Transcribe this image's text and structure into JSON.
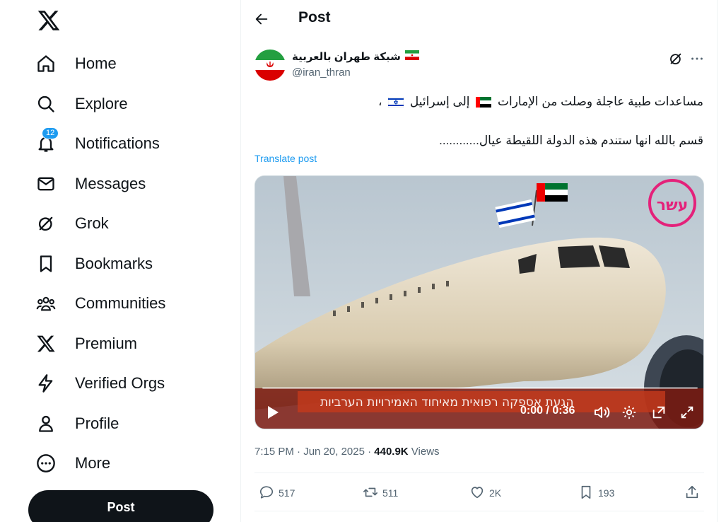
{
  "nav": {
    "items": [
      {
        "label": "Home",
        "icon": "home-icon"
      },
      {
        "label": "Explore",
        "icon": "search-icon"
      },
      {
        "label": "Notifications",
        "icon": "bell-icon",
        "badge": "12"
      },
      {
        "label": "Messages",
        "icon": "mail-icon"
      },
      {
        "label": "Grok",
        "icon": "grok-icon"
      },
      {
        "label": "Bookmarks",
        "icon": "bookmark-icon"
      },
      {
        "label": "Communities",
        "icon": "communities-icon"
      },
      {
        "label": "Premium",
        "icon": "x-logo-icon"
      },
      {
        "label": "Verified Orgs",
        "icon": "lightning-icon"
      },
      {
        "label": "Profile",
        "icon": "person-icon"
      },
      {
        "label": "More",
        "icon": "more-circle-icon"
      }
    ],
    "post_button": "Post"
  },
  "header": {
    "title": "Post"
  },
  "post": {
    "display_name": "شبكة طهران بالعربية",
    "handle": "@iran_thran",
    "line1_a": "مساعدات طبية عاجلة وصلت من الإمارات",
    "line1_b": "إلى إسرائيل",
    "line1_c": "،",
    "line2": "قسم بالله انها ستندم هذه الدولة اللقيطة عيال............",
    "translate_label": "Translate post",
    "video": {
      "time": "0:00 / 0:36",
      "caption": "הגעת אספקה רפואית מאיחוד האמירויות הערביות",
      "progress": 0
    },
    "timestamp": "7:15 PM · Jun 20, 2025 · ",
    "views_count": "440.9K",
    "views_label": " Views",
    "stats": {
      "replies": "517",
      "reposts": "511",
      "likes": "2K",
      "bookmarks": "193"
    }
  },
  "colors": {
    "accent": "#1d9bf0",
    "text": "#0f1419",
    "muted": "#536471",
    "button_dark": "#0f1419"
  }
}
